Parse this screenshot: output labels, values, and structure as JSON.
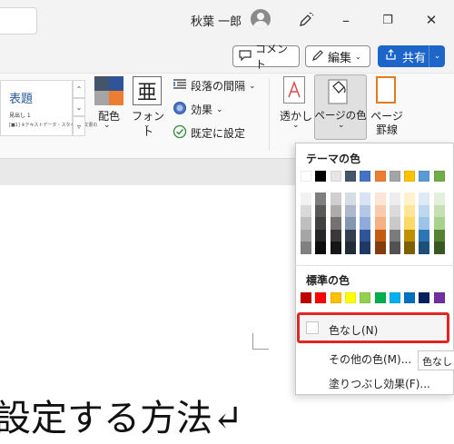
{
  "titlebar": {
    "user_name": "秋葉 一郎",
    "minimize": "–",
    "restore": "❐",
    "close": "✕",
    "pen_icon": "pen-sparkle-icon"
  },
  "actions": {
    "comment_label": "コメント",
    "edit_label": "編集",
    "share_label": "共有"
  },
  "ribbon": {
    "style_gallery": {
      "title": "表題",
      "sub1": "見出し 1",
      "sub2": "[■1] ※テキストデータ・スタイル。文書の"
    },
    "colors_label": "配色",
    "fonts_label": "フォント",
    "fonts_glyph": "亜",
    "paragraph_spacing_label": "段落の間隔",
    "effects_label": "効果",
    "set_default_label": "既定に設定",
    "watermark_label": "透かし",
    "page_color_label": "ページの色",
    "page_border_label_1": "ページ",
    "page_border_label_2": "罫線",
    "colors_icon_quads": [
      "#44546a",
      "#2f5597",
      "#a5a5a5",
      "#ed7d31"
    ]
  },
  "dropdown": {
    "theme_colors_label": "テーマの色",
    "theme_columns": [
      [
        "#ffffff",
        "#f2f2f2",
        "#d9d9d9",
        "#bfbfbf",
        "#a6a6a6",
        "#808080"
      ],
      [
        "#000000",
        "#7f7f7f",
        "#595959",
        "#404040",
        "#262626",
        "#0d0d0d"
      ],
      [
        "#e7e6e6",
        "#d0cece",
        "#aeabab",
        "#767171",
        "#3a3838",
        "#171616"
      ],
      [
        "#44546a",
        "#d6dce4",
        "#adb9ca",
        "#8497b0",
        "#333f4f",
        "#222a35"
      ],
      [
        "#4472c4",
        "#dae3f3",
        "#b4c7e7",
        "#8faadc",
        "#2f5597",
        "#1f3864"
      ],
      [
        "#ed7d31",
        "#fbe5d6",
        "#f8cbad",
        "#f4b183",
        "#c55a11",
        "#843c0c"
      ],
      [
        "#a5a5a5",
        "#ededed",
        "#dbdbdb",
        "#c9c9c9",
        "#7b7b7b",
        "#525252"
      ],
      [
        "#ffc000",
        "#fff2cc",
        "#ffe699",
        "#ffd966",
        "#bf9000",
        "#7f6000"
      ],
      [
        "#5b9bd5",
        "#deebf7",
        "#bdd7ee",
        "#9dc3e6",
        "#2e75b6",
        "#1f4e79"
      ],
      [
        "#70ad47",
        "#e2f0d9",
        "#c5e0b4",
        "#a9d18e",
        "#548235",
        "#385723"
      ]
    ],
    "standard_colors_label": "標準の色",
    "standard_colors": [
      "#c00000",
      "#ff0000",
      "#ffc000",
      "#ffff00",
      "#92d050",
      "#00b050",
      "#00b0f0",
      "#0070c0",
      "#002060",
      "#7030a0"
    ],
    "no_color_label": "色なし(N)",
    "more_colors_label": "その他の色(M)...",
    "fill_effects_label": "塗りつぶし効果(F)..."
  },
  "tooltip_text": "色なし",
  "document": {
    "heading_text": "設定する方法↵"
  }
}
